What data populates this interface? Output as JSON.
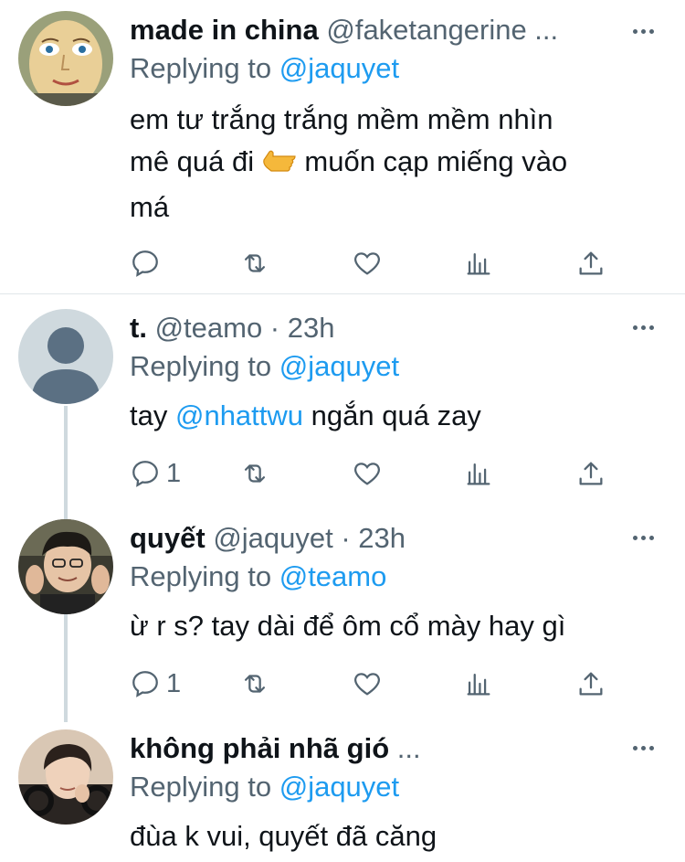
{
  "colors": {
    "accent": "#1d9bf0",
    "muted": "#536471",
    "text": "#0f1419"
  },
  "tweets": [
    {
      "name": "made in china",
      "handle": "@faketangerine ...",
      "replying_prefix": "Replying to",
      "replying_to": "@jaquyet",
      "text_line1": "em tư trắng trắng mềm mềm nhìn",
      "text_line2a": "mê quá đi",
      "emoji": "backhand-index-pointing-left",
      "text_line2b": "muốn cạp miếng vào",
      "text_line3": "má",
      "reply_count": ""
    },
    {
      "name": "t.",
      "handle": "@teamo · 23h",
      "replying_prefix": "Replying to",
      "replying_to": "@jaquyet",
      "text_a": "tay",
      "mention": "@nhattwu",
      "text_b": "ngắn quá zay",
      "reply_count": "1"
    },
    {
      "name": "quyết",
      "handle": "@jaquyet · 23h",
      "replying_prefix": "Replying to",
      "replying_to": "@teamo",
      "text": "ừ r s? tay dài để ôm cổ mày hay gì",
      "reply_count": "1"
    },
    {
      "name": "không phải nhã gió",
      "handle": "...",
      "replying_prefix": "Replying to",
      "replying_to": "@jaquyet",
      "text": "đùa k vui, quyết đã căng"
    }
  ],
  "icons": [
    "reply-icon",
    "retweet-icon",
    "like-icon",
    "analytics-icon",
    "share-icon",
    "more-icon"
  ]
}
